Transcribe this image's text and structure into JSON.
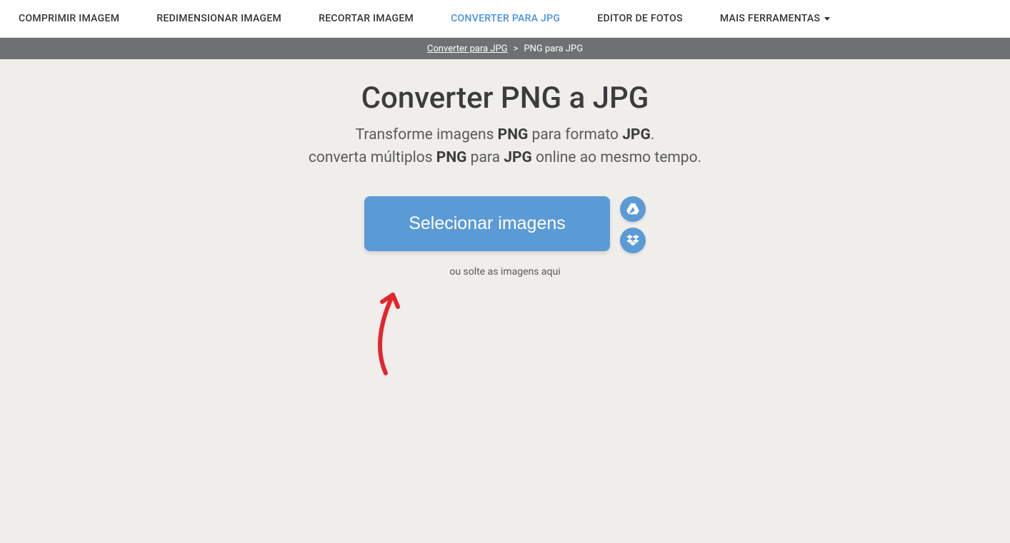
{
  "nav": {
    "items": [
      {
        "label": "COMPRIMIR IMAGEM",
        "active": false
      },
      {
        "label": "REDIMENSIONAR IMAGEM",
        "active": false
      },
      {
        "label": "RECORTAR IMAGEM",
        "active": false
      },
      {
        "label": "CONVERTER PARA JPG",
        "active": true
      },
      {
        "label": "EDITOR DE FOTOS",
        "active": false
      },
      {
        "label": "MAIS FERRAMENTAS",
        "active": false,
        "dropdown": true
      }
    ]
  },
  "breadcrumb": {
    "link": "Converter para JPG",
    "separator": ">",
    "current": "PNG para JPG"
  },
  "main": {
    "title": "Converter PNG a JPG",
    "subtitle_line1_prefix": "Transforme imagens ",
    "subtitle_line1_bold1": "PNG",
    "subtitle_line1_mid": " para formato ",
    "subtitle_line1_bold2": "JPG",
    "subtitle_line1_suffix": ".",
    "subtitle_line2_prefix": "converta múltiplos ",
    "subtitle_line2_bold1": "PNG",
    "subtitle_line2_mid": " para ",
    "subtitle_line2_bold2": "JPG",
    "subtitle_line2_suffix": " online ao mesmo tempo.",
    "select_button": "Selecionar imagens",
    "drop_hint": "ou solte as imagens aqui"
  }
}
